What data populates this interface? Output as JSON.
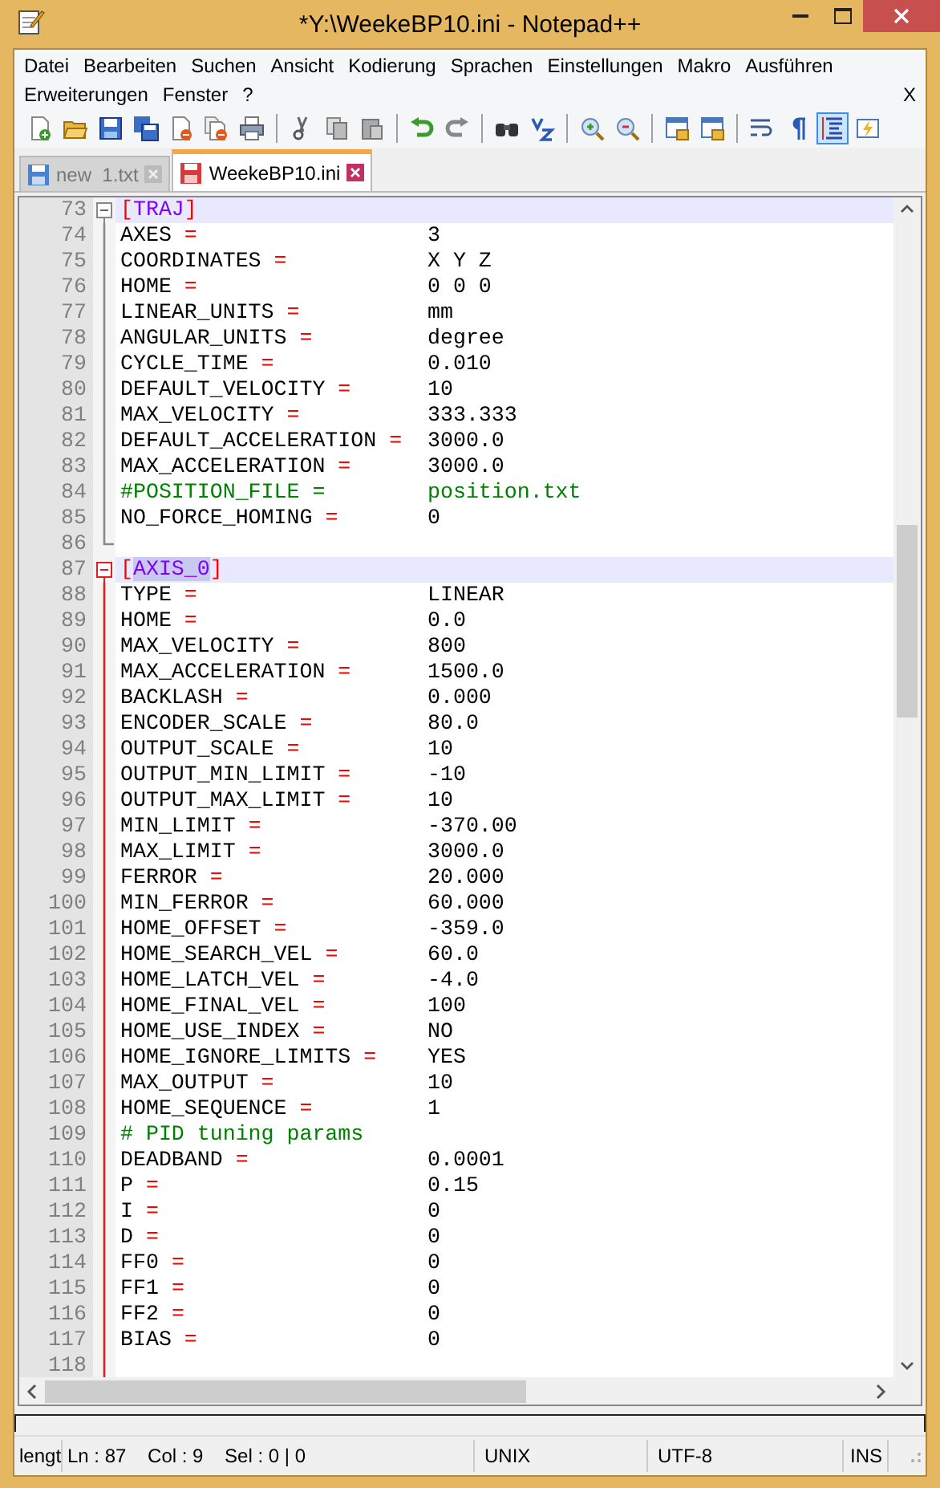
{
  "window": {
    "title": "*Y:\\WeekeBP10.ini - Notepad++"
  },
  "menu": {
    "rows": [
      [
        "Datei",
        "Bearbeiten",
        "Suchen",
        "Ansicht",
        "Kodierung",
        "Sprachen",
        "Einstellungen",
        "Makro",
        "Ausführen"
      ],
      [
        "Erweiterungen",
        "Fenster",
        "?"
      ]
    ],
    "close_label": "X"
  },
  "toolbar": [
    {
      "kind": "new"
    },
    {
      "kind": "open"
    },
    {
      "kind": "save"
    },
    {
      "kind": "save_all"
    },
    {
      "kind": "close"
    },
    {
      "kind": "close_all"
    },
    {
      "kind": "print"
    },
    {
      "kind": "separator"
    },
    {
      "kind": "cut"
    },
    {
      "kind": "copy"
    },
    {
      "kind": "paste"
    },
    {
      "kind": "separator"
    },
    {
      "kind": "undo"
    },
    {
      "kind": "redo"
    },
    {
      "kind": "separator"
    },
    {
      "kind": "find"
    },
    {
      "kind": "replace"
    },
    {
      "kind": "separator"
    },
    {
      "kind": "zoom_in"
    },
    {
      "kind": "zoom_out"
    },
    {
      "kind": "separator"
    },
    {
      "kind": "sync_v"
    },
    {
      "kind": "sync_h"
    },
    {
      "kind": "separator"
    },
    {
      "kind": "wrap",
      "on": false
    },
    {
      "kind": "all_chars",
      "on": false
    },
    {
      "kind": "indent_guide",
      "on": true
    },
    {
      "kind": "macro",
      "on": false
    }
  ],
  "tabs": [
    {
      "label": "new  1.txt",
      "selected": false,
      "modified": false
    },
    {
      "label": "WeekeBP10.ini",
      "selected": true,
      "modified": true
    }
  ],
  "editor": {
    "lines": [
      {
        "number": "73",
        "kind": "section",
        "open": "[",
        "name": "TRAJ",
        "close": "]",
        "highlighted": true,
        "active": false
      },
      {
        "number": "74",
        "kind": "pair",
        "key": "AXES",
        "op": "=",
        "value": "3"
      },
      {
        "number": "75",
        "kind": "pair",
        "key": "COORDINATES",
        "op": "=",
        "value": "X Y Z"
      },
      {
        "number": "76",
        "kind": "pair",
        "key": "HOME",
        "op": "=",
        "value": "0 0 0"
      },
      {
        "number": "77",
        "kind": "pair",
        "key": "LINEAR_UNITS",
        "op": "=",
        "value": "mm"
      },
      {
        "number": "78",
        "kind": "pair",
        "key": "ANGULAR_UNITS",
        "op": "=",
        "value": "degree"
      },
      {
        "number": "79",
        "kind": "pair",
        "key": "CYCLE_TIME",
        "op": "=",
        "value": "0.010"
      },
      {
        "number": "80",
        "kind": "pair",
        "key": "DEFAULT_VELOCITY",
        "op": "=",
        "value": "10"
      },
      {
        "number": "81",
        "kind": "pair",
        "key": "MAX_VELOCITY",
        "op": "=",
        "value": "333.333"
      },
      {
        "number": "82",
        "kind": "pair",
        "key": "DEFAULT_ACCELERATION",
        "op": "=",
        "value": "3000.0"
      },
      {
        "number": "83",
        "kind": "pair",
        "key": "MAX_ACCELERATION",
        "op": "=",
        "value": "3000.0"
      },
      {
        "number": "84",
        "kind": "comment_pair",
        "key": "#POSITION_FILE",
        "op": "=",
        "value": "position.txt"
      },
      {
        "number": "85",
        "kind": "pair",
        "key": "NO_FORCE_HOMING",
        "op": "=",
        "value": "0"
      },
      {
        "number": "86",
        "kind": "blank"
      },
      {
        "number": "87",
        "kind": "section",
        "open": "[",
        "name": "AXIS_0",
        "close": "]",
        "highlighted": true,
        "active": true
      },
      {
        "number": "88",
        "kind": "pair",
        "key": "TYPE",
        "op": "=",
        "value": "LINEAR"
      },
      {
        "number": "89",
        "kind": "pair",
        "key": "HOME",
        "op": "=",
        "value": "0.0"
      },
      {
        "number": "90",
        "kind": "pair",
        "key": "MAX_VELOCITY",
        "op": "=",
        "value": "800"
      },
      {
        "number": "91",
        "kind": "pair",
        "key": "MAX_ACCELERATION",
        "op": "=",
        "value": "1500.0"
      },
      {
        "number": "92",
        "kind": "pair",
        "key": "BACKLASH",
        "op": "=",
        "value": "0.000"
      },
      {
        "number": "93",
        "kind": "pair",
        "key": "ENCODER_SCALE",
        "op": "=",
        "value": "80.0"
      },
      {
        "number": "94",
        "kind": "pair",
        "key": "OUTPUT_SCALE",
        "op": "=",
        "value": "10"
      },
      {
        "number": "95",
        "kind": "pair",
        "key": "OUTPUT_MIN_LIMIT",
        "op": "=",
        "value": "-10"
      },
      {
        "number": "96",
        "kind": "pair",
        "key": "OUTPUT_MAX_LIMIT",
        "op": "=",
        "value": "10"
      },
      {
        "number": "97",
        "kind": "pair",
        "key": "MIN_LIMIT",
        "op": "=",
        "value": "-370.00"
      },
      {
        "number": "98",
        "kind": "pair",
        "key": "MAX_LIMIT",
        "op": "=",
        "value": "3000.0"
      },
      {
        "number": "99",
        "kind": "pair",
        "key": "FERROR",
        "op": "=",
        "value": "20.000"
      },
      {
        "number": "100",
        "kind": "pair",
        "key": "MIN_FERROR",
        "op": "=",
        "value": "60.000"
      },
      {
        "number": "101",
        "kind": "pair",
        "key": "HOME_OFFSET",
        "op": "=",
        "value": "-359.0"
      },
      {
        "number": "102",
        "kind": "pair",
        "key": "HOME_SEARCH_VEL",
        "op": "=",
        "value": "60.0"
      },
      {
        "number": "103",
        "kind": "pair",
        "key": "HOME_LATCH_VEL",
        "op": "=",
        "value": "-4.0"
      },
      {
        "number": "104",
        "kind": "pair",
        "key": "HOME_FINAL_VEL",
        "op": "=",
        "value": "100"
      },
      {
        "number": "105",
        "kind": "pair",
        "key": "HOME_USE_INDEX",
        "op": "=",
        "value": "NO"
      },
      {
        "number": "106",
        "kind": "pair",
        "key": "HOME_IGNORE_LIMITS",
        "op": "=",
        "value": "YES"
      },
      {
        "number": "107",
        "kind": "pair",
        "key": "MAX_OUTPUT",
        "op": "=",
        "value": "10"
      },
      {
        "number": "108",
        "kind": "pair",
        "key": "HOME_SEQUENCE",
        "op": "=",
        "value": "1"
      },
      {
        "number": "109",
        "kind": "comment",
        "text": "# PID tuning params"
      },
      {
        "number": "110",
        "kind": "pair",
        "key": "DEADBAND",
        "op": "=",
        "value": "0.0001"
      },
      {
        "number": "111",
        "kind": "pair",
        "key": "P",
        "op": "=",
        "value": "0.15"
      },
      {
        "number": "112",
        "kind": "pair",
        "key": "I",
        "op": "=",
        "value": "0"
      },
      {
        "number": "113",
        "kind": "pair",
        "key": "D",
        "op": "=",
        "value": "0"
      },
      {
        "number": "114",
        "kind": "pair",
        "key": "FF0",
        "op": "=",
        "value": "0"
      },
      {
        "number": "115",
        "kind": "pair",
        "key": "FF1",
        "op": "=",
        "value": "0"
      },
      {
        "number": "116",
        "kind": "pair",
        "key": "FF2",
        "op": "=",
        "value": "0"
      },
      {
        "number": "117",
        "kind": "pair",
        "key": "BIAS",
        "op": "=",
        "value": "0"
      },
      {
        "number": "118",
        "kind": "blank"
      }
    ]
  },
  "status_bar": {
    "doc": "lengt",
    "position": "Ln : 87    Col : 9    Sel : 0 | 0",
    "eol": "UNIX",
    "encoding": "UTF-8",
    "mode": "INS"
  }
}
